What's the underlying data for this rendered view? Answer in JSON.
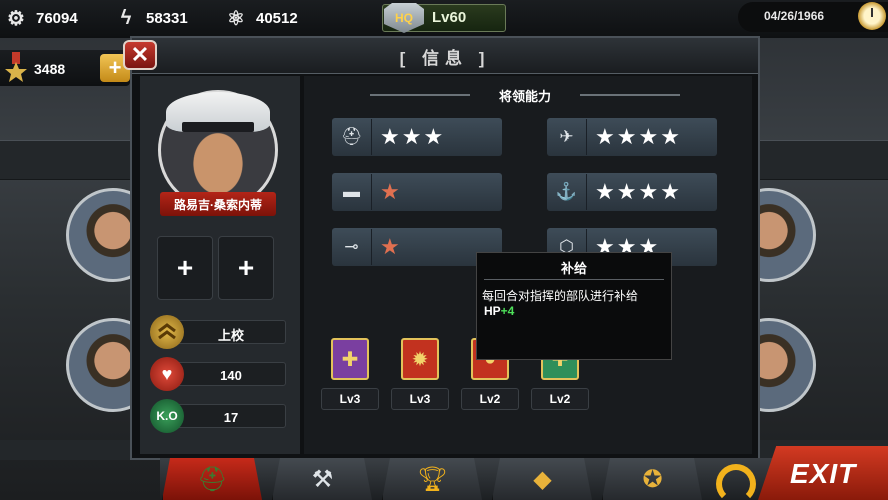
{
  "resources": {
    "gear": {
      "value": "76094",
      "icon": "gear-icon"
    },
    "lightning": {
      "value": "58331",
      "icon": "lightning-icon"
    },
    "atom": {
      "value": "40512",
      "icon": "atom-icon"
    },
    "medal": {
      "value": "3488",
      "icon": "medal-icon"
    }
  },
  "hq": {
    "badge": "HQ",
    "level": "Lv60"
  },
  "date": "04/26/1966",
  "panel": {
    "title": "[ 信息 ]",
    "close_icon": "close-icon"
  },
  "general": {
    "name": "路易吉·桑索内蒂",
    "slots": [
      "+",
      "+"
    ],
    "stats": [
      {
        "icon": "rank-icon",
        "value": "上校"
      },
      {
        "icon": "heart-icon",
        "value": "140"
      },
      {
        "icon": "ko-icon",
        "label": "K.O",
        "value": "17"
      }
    ]
  },
  "abilities": {
    "title": "将领能力",
    "items": [
      {
        "icon": "infantry-icon",
        "stars": 3,
        "color": "white"
      },
      {
        "icon": "airforce-icon",
        "stars": 4,
        "color": "white"
      },
      {
        "icon": "tank-icon",
        "stars": 1,
        "color": "orange"
      },
      {
        "icon": "navy-icon",
        "stars": 4,
        "color": "white"
      },
      {
        "icon": "artillery-icon",
        "stars": 1,
        "color": "orange"
      },
      {
        "icon": "supply-icon",
        "stars": 3,
        "color": "white"
      }
    ]
  },
  "tooltip": {
    "title": "补给",
    "description": "每回合对指挥的部队进行补给",
    "hp_label": "HP",
    "hp_value": "+4"
  },
  "medals": [
    {
      "level": "Lv3",
      "color": "#7a3fa0"
    },
    {
      "level": "Lv3",
      "color": "#c2321f"
    },
    {
      "level": "Lv2",
      "color": "#c2321f"
    },
    {
      "level": "Lv2",
      "color": "#2f8f5a"
    }
  ],
  "bottom_nav": {
    "tabs": [
      "general-tab",
      "tools-tab",
      "trophy-tab",
      "diamond-tab",
      "medal-tab"
    ],
    "exit": "EXIT"
  },
  "colors": {
    "accent_red": "#c2321f",
    "gold": "#f2b21c",
    "hp_green": "#4ee05a"
  }
}
